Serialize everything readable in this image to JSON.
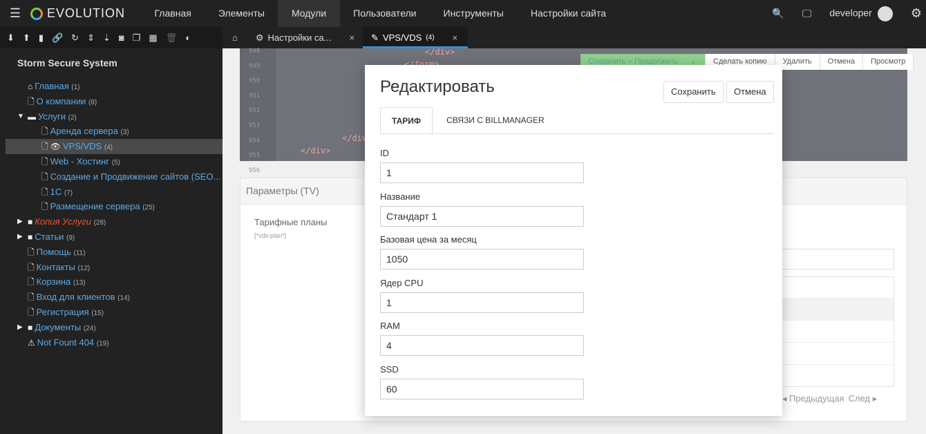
{
  "topbar": {
    "brand": "EVOLUTION",
    "menu": [
      "Главная",
      "Элементы",
      "Модули",
      "Пользователи",
      "Инструменты",
      "Настройки сайта"
    ],
    "active_menu": 2,
    "user": "developer"
  },
  "toolbar_icons": [
    "arrow-down-circle-icon",
    "arrow-up-circle-icon",
    "file-icon",
    "link-icon",
    "refresh-icon",
    "sort-icon",
    "sort-numeric-icon",
    "camera-icon",
    "copy-icon",
    "grid-icon",
    "trash-icon",
    "contrast-icon"
  ],
  "sidebar": {
    "site_name": "Storm Secure System",
    "items": [
      {
        "label": "Главная",
        "count": "(1)",
        "icon": "home-icon",
        "level": 0
      },
      {
        "label": "О компании",
        "count": "(8)",
        "icon": "file-icon",
        "level": 0
      },
      {
        "label": "Услуги",
        "count": "(2)",
        "icon": "folder-open-icon",
        "level": 0,
        "expanded": true
      },
      {
        "label": "Аренда сервера",
        "count": "(3)",
        "icon": "file-icon",
        "level": 1
      },
      {
        "label": "VPS/VDS",
        "count": "(4)",
        "icon": "file-icon",
        "level": 1,
        "active": true
      },
      {
        "label": "Web - Хостинг",
        "count": "(5)",
        "icon": "file-icon",
        "level": 1
      },
      {
        "label": "Создание и Продвижение сайтов (SEO...",
        "count": "",
        "icon": "file-icon",
        "level": 1
      },
      {
        "label": "1С",
        "count": "(7)",
        "icon": "file-icon",
        "level": 1
      },
      {
        "label": "Размещение сервера",
        "count": "(25)",
        "icon": "file-icon",
        "level": 1
      },
      {
        "label": "Копия Услуги",
        "count": "(28)",
        "icon": "folder-icon",
        "level": 0,
        "collapsed": true,
        "italic_red": true
      },
      {
        "label": "Статьи",
        "count": "(9)",
        "icon": "folder-icon",
        "level": 0,
        "collapsed": true
      },
      {
        "label": "Помощь",
        "count": "(11)",
        "icon": "file-icon",
        "level": 0
      },
      {
        "label": "Контакты",
        "count": "(12)",
        "icon": "file-icon",
        "level": 0
      },
      {
        "label": "Корзина",
        "count": "(13)",
        "icon": "file-icon",
        "level": 0
      },
      {
        "label": "Вход для клиентов",
        "count": "(14)",
        "icon": "file-icon",
        "level": 0
      },
      {
        "label": "Регистрация",
        "count": "(15)",
        "icon": "file-icon",
        "level": 0
      },
      {
        "label": "Документы",
        "count": "(24)",
        "icon": "folder-icon",
        "level": 0,
        "collapsed": true
      },
      {
        "label": "Not Fount 404",
        "count": "(19)",
        "icon": "warning-icon",
        "level": 0
      }
    ]
  },
  "tabs": [
    {
      "label": "Настройки са..."
    },
    {
      "label": "VPS/VDS",
      "count": "(4)",
      "active": true
    }
  ],
  "editor": {
    "line_numbers": [
      "948",
      "949",
      "950",
      "951",
      "952",
      "953",
      "954",
      "955",
      "956"
    ],
    "lines": [
      "</div>",
      "</form>",
      "</div>",
      "</div>"
    ]
  },
  "actions": [
    "Сохранить + Продолжить",
    "Сделать копию",
    "Удалить",
    "Отмена",
    "Просмотр"
  ],
  "panel": {
    "title": "Параметры (TV)",
    "tv_label": "Тарифные планы",
    "tv_name": "[*vds-plan*]",
    "pager_prev": "Предыдущая",
    "pager_next": "След"
  },
  "modal": {
    "title": "Редактировать",
    "save": "Сохранить",
    "cancel": "Отмена",
    "tabs": [
      "ТАРИФ",
      "СВЯЗИ С BILLMANAGER"
    ],
    "fields": [
      {
        "label": "ID",
        "value": "1"
      },
      {
        "label": "Название",
        "value": "Стандарт 1"
      },
      {
        "label": "Базовая цена за месяц",
        "value": "1050"
      },
      {
        "label": "Ядер CPU",
        "value": "1"
      },
      {
        "label": "RAM",
        "value": "4"
      },
      {
        "label": "SSD",
        "value": "60"
      }
    ]
  }
}
